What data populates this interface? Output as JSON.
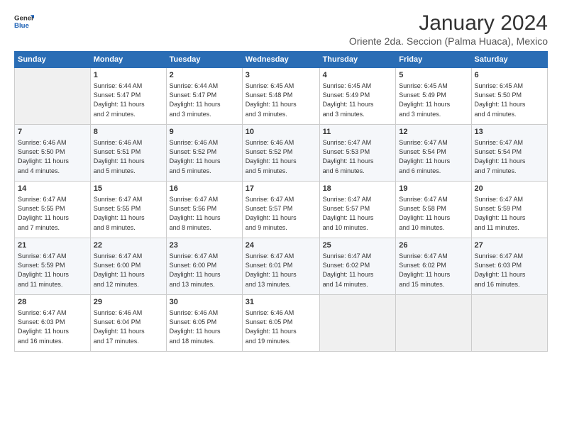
{
  "header": {
    "title": "January 2024",
    "location": "Oriente 2da. Seccion (Palma Huaca), Mexico"
  },
  "days_of_week": [
    "Sunday",
    "Monday",
    "Tuesday",
    "Wednesday",
    "Thursday",
    "Friday",
    "Saturday"
  ],
  "weeks": [
    [
      {
        "num": "",
        "info": ""
      },
      {
        "num": "1",
        "info": "Sunrise: 6:44 AM\nSunset: 5:47 PM\nDaylight: 11 hours\nand 2 minutes."
      },
      {
        "num": "2",
        "info": "Sunrise: 6:44 AM\nSunset: 5:47 PM\nDaylight: 11 hours\nand 3 minutes."
      },
      {
        "num": "3",
        "info": "Sunrise: 6:45 AM\nSunset: 5:48 PM\nDaylight: 11 hours\nand 3 minutes."
      },
      {
        "num": "4",
        "info": "Sunrise: 6:45 AM\nSunset: 5:49 PM\nDaylight: 11 hours\nand 3 minutes."
      },
      {
        "num": "5",
        "info": "Sunrise: 6:45 AM\nSunset: 5:49 PM\nDaylight: 11 hours\nand 3 minutes."
      },
      {
        "num": "6",
        "info": "Sunrise: 6:45 AM\nSunset: 5:50 PM\nDaylight: 11 hours\nand 4 minutes."
      }
    ],
    [
      {
        "num": "7",
        "info": "Sunrise: 6:46 AM\nSunset: 5:50 PM\nDaylight: 11 hours\nand 4 minutes."
      },
      {
        "num": "8",
        "info": "Sunrise: 6:46 AM\nSunset: 5:51 PM\nDaylight: 11 hours\nand 5 minutes."
      },
      {
        "num": "9",
        "info": "Sunrise: 6:46 AM\nSunset: 5:52 PM\nDaylight: 11 hours\nand 5 minutes."
      },
      {
        "num": "10",
        "info": "Sunrise: 6:46 AM\nSunset: 5:52 PM\nDaylight: 11 hours\nand 5 minutes."
      },
      {
        "num": "11",
        "info": "Sunrise: 6:47 AM\nSunset: 5:53 PM\nDaylight: 11 hours\nand 6 minutes."
      },
      {
        "num": "12",
        "info": "Sunrise: 6:47 AM\nSunset: 5:54 PM\nDaylight: 11 hours\nand 6 minutes."
      },
      {
        "num": "13",
        "info": "Sunrise: 6:47 AM\nSunset: 5:54 PM\nDaylight: 11 hours\nand 7 minutes."
      }
    ],
    [
      {
        "num": "14",
        "info": "Sunrise: 6:47 AM\nSunset: 5:55 PM\nDaylight: 11 hours\nand 7 minutes."
      },
      {
        "num": "15",
        "info": "Sunrise: 6:47 AM\nSunset: 5:55 PM\nDaylight: 11 hours\nand 8 minutes."
      },
      {
        "num": "16",
        "info": "Sunrise: 6:47 AM\nSunset: 5:56 PM\nDaylight: 11 hours\nand 8 minutes."
      },
      {
        "num": "17",
        "info": "Sunrise: 6:47 AM\nSunset: 5:57 PM\nDaylight: 11 hours\nand 9 minutes."
      },
      {
        "num": "18",
        "info": "Sunrise: 6:47 AM\nSunset: 5:57 PM\nDaylight: 11 hours\nand 10 minutes."
      },
      {
        "num": "19",
        "info": "Sunrise: 6:47 AM\nSunset: 5:58 PM\nDaylight: 11 hours\nand 10 minutes."
      },
      {
        "num": "20",
        "info": "Sunrise: 6:47 AM\nSunset: 5:59 PM\nDaylight: 11 hours\nand 11 minutes."
      }
    ],
    [
      {
        "num": "21",
        "info": "Sunrise: 6:47 AM\nSunset: 5:59 PM\nDaylight: 11 hours\nand 11 minutes."
      },
      {
        "num": "22",
        "info": "Sunrise: 6:47 AM\nSunset: 6:00 PM\nDaylight: 11 hours\nand 12 minutes."
      },
      {
        "num": "23",
        "info": "Sunrise: 6:47 AM\nSunset: 6:00 PM\nDaylight: 11 hours\nand 13 minutes."
      },
      {
        "num": "24",
        "info": "Sunrise: 6:47 AM\nSunset: 6:01 PM\nDaylight: 11 hours\nand 13 minutes."
      },
      {
        "num": "25",
        "info": "Sunrise: 6:47 AM\nSunset: 6:02 PM\nDaylight: 11 hours\nand 14 minutes."
      },
      {
        "num": "26",
        "info": "Sunrise: 6:47 AM\nSunset: 6:02 PM\nDaylight: 11 hours\nand 15 minutes."
      },
      {
        "num": "27",
        "info": "Sunrise: 6:47 AM\nSunset: 6:03 PM\nDaylight: 11 hours\nand 16 minutes."
      }
    ],
    [
      {
        "num": "28",
        "info": "Sunrise: 6:47 AM\nSunset: 6:03 PM\nDaylight: 11 hours\nand 16 minutes."
      },
      {
        "num": "29",
        "info": "Sunrise: 6:46 AM\nSunset: 6:04 PM\nDaylight: 11 hours\nand 17 minutes."
      },
      {
        "num": "30",
        "info": "Sunrise: 6:46 AM\nSunset: 6:05 PM\nDaylight: 11 hours\nand 18 minutes."
      },
      {
        "num": "31",
        "info": "Sunrise: 6:46 AM\nSunset: 6:05 PM\nDaylight: 11 hours\nand 19 minutes."
      },
      {
        "num": "",
        "info": ""
      },
      {
        "num": "",
        "info": ""
      },
      {
        "num": "",
        "info": ""
      }
    ]
  ]
}
